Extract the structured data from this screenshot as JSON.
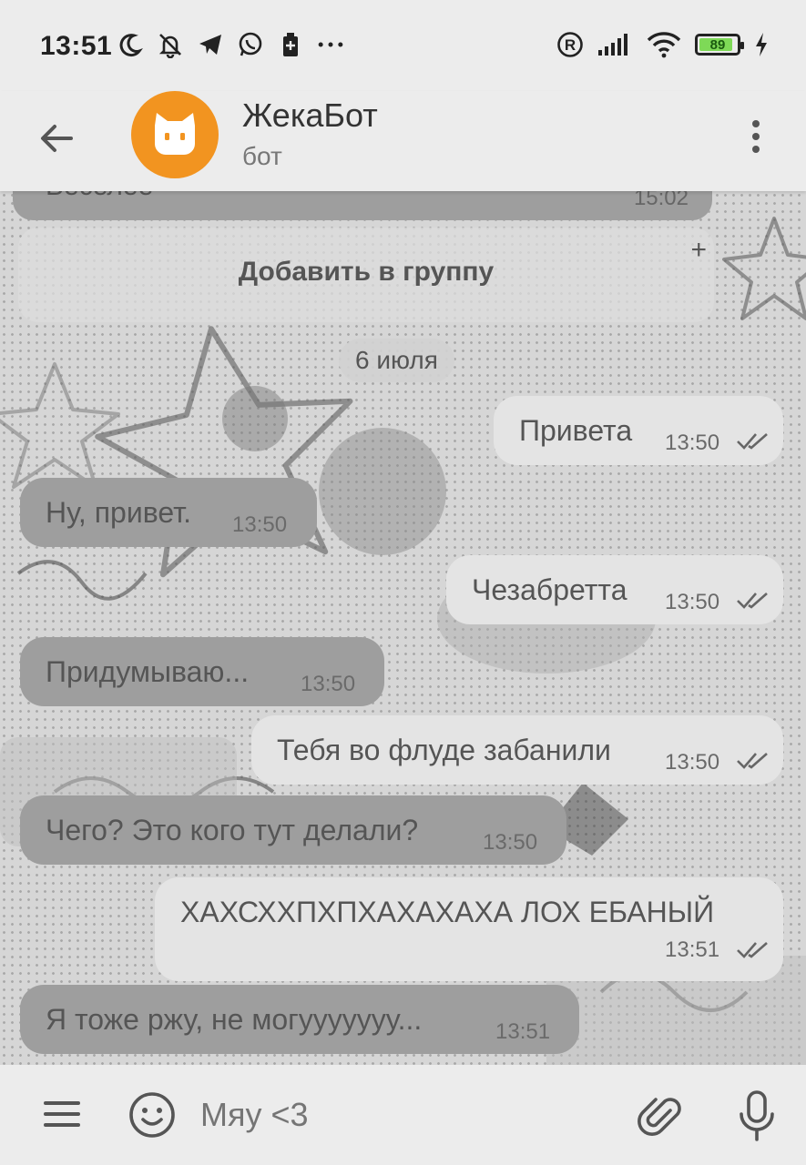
{
  "status_bar": {
    "time": "13:51",
    "left_icons": [
      "moon-icon",
      "bell-off-icon",
      "telegram-icon",
      "whatsapp-icon",
      "battery-saver-icon",
      "more-dots-icon"
    ],
    "right_icons": [
      "registered-icon",
      "signal-icon",
      "wifi-icon",
      "battery-icon",
      "charging-icon"
    ],
    "battery_level": "89"
  },
  "header": {
    "title": "ЖекаБот",
    "subtitle": "бот",
    "avatar_icon": "cat-face-icon",
    "back_icon": "arrow-left-icon",
    "menu_icon": "kebab-menu-icon"
  },
  "chat": {
    "previous_message": {
      "text": "Веселее",
      "time": "15:02"
    },
    "add_to_group": {
      "label": "Добавить в группу",
      "icon": "+"
    },
    "date_separator": "6 июля",
    "messages": [
      {
        "direction": "out",
        "text": "Привета",
        "time": "13:50",
        "read": true
      },
      {
        "direction": "in",
        "text": "Ну, привет.",
        "time": "13:50"
      },
      {
        "direction": "out",
        "text": "Чезабретта",
        "time": "13:50",
        "read": true
      },
      {
        "direction": "in",
        "text": "Придумываю...",
        "time": "13:50"
      },
      {
        "direction": "out",
        "text": "Тебя во флуде забанили",
        "time": "13:50",
        "read": true
      },
      {
        "direction": "in",
        "text": "Чего? Это кого тут делали?",
        "time": "13:50"
      },
      {
        "direction": "out",
        "text": "ХАХСХХПХПХАХАХАХА ЛОХ ЕБАНЫЙ",
        "time": "13:51",
        "read": true
      },
      {
        "direction": "in",
        "text": "Я тоже ржу, не могууууууу...",
        "time": "13:51"
      }
    ]
  },
  "input_bar": {
    "placeholder": "Мяу <3",
    "icons": [
      "menu-icon",
      "emoji-icon",
      "paperclip-icon",
      "microphone-icon"
    ]
  },
  "colors": {
    "avatar_bg": "#f29420",
    "battery_fill": "#7ed957",
    "incoming_bubble": "#9e9e9e",
    "outgoing_bubble": "#e4e4e4"
  }
}
